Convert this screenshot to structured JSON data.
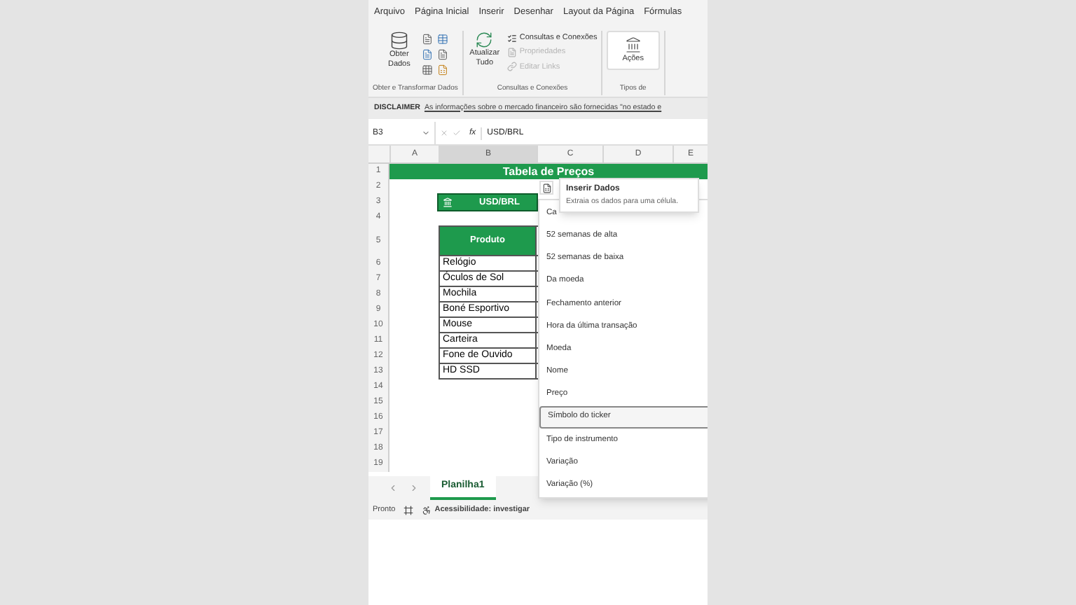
{
  "ribbon_tabs": [
    "Arquivo",
    "Página Inicial",
    "Inserir",
    "Desenhar",
    "Layout da Página",
    "Fórmulas"
  ],
  "ribbon_groups": [
    {
      "kind": "data",
      "label": "Obter e Transformar Dados",
      "large_button": "Obter Dados"
    },
    {
      "kind": "queries",
      "label": "Consultas e Conexões",
      "large_button": "Atualizar Tudo",
      "small_buttons": [
        {
          "label": "Consultas e Conexões",
          "disabled": false
        },
        {
          "label": "Propriedades",
          "disabled": true
        },
        {
          "label": "Editar Links",
          "disabled": true
        }
      ]
    },
    {
      "kind": "types",
      "label": "Tipos de",
      "large_button": "Ações"
    }
  ],
  "disclaimer": {
    "label": "DISCLAIMER",
    "link": "As informações sobre o mercado financeiro são fornecidas \"no estado e"
  },
  "formula_bar": {
    "name_box": "B3",
    "fx": "fx",
    "value": "USD/BRL"
  },
  "sheet": {
    "columns": [
      "A",
      "B",
      "C",
      "D",
      "E"
    ],
    "rows": [
      {
        "number": "1",
        "kind": "title",
        "text": "Tabela de Preços"
      },
      {
        "number": "2",
        "kind": "empty"
      },
      {
        "number": "3",
        "kind": "ticker",
        "text": "USD/BRL",
        "selected": true
      },
      {
        "number": "4",
        "kind": "empty"
      },
      {
        "number": "5",
        "kind": "header",
        "text": "Produto"
      },
      {
        "number": "6",
        "kind": "product",
        "text": "Relógio"
      },
      {
        "number": "7",
        "kind": "product",
        "text": "Óculos de Sol"
      },
      {
        "number": "8",
        "kind": "product",
        "text": "Mochila"
      },
      {
        "number": "9",
        "kind": "product",
        "text": "Boné Esportivo"
      },
      {
        "number": "10",
        "kind": "product",
        "text": "Mouse"
      },
      {
        "number": "11",
        "kind": "product",
        "text": "Carteira"
      },
      {
        "number": "12",
        "kind": "product",
        "text": "Fone de Ouvido"
      },
      {
        "number": "13",
        "kind": "product",
        "text": "HD SSD"
      },
      {
        "number": "14",
        "kind": "empty"
      },
      {
        "number": "15",
        "kind": "empty"
      },
      {
        "number": "16",
        "kind": "empty"
      },
      {
        "number": "17",
        "kind": "empty"
      },
      {
        "number": "18",
        "kind": "empty"
      },
      {
        "number": "19",
        "kind": "empty"
      }
    ]
  },
  "tooltip": {
    "title": "Inserir Dados",
    "description": "Extraia os dados para uma célula."
  },
  "menu": {
    "items": [
      {
        "label": "Ca",
        "selected": false
      },
      {
        "label": "52 semanas de alta",
        "selected": false
      },
      {
        "label": "52 semanas de baixa",
        "selected": false
      },
      {
        "label": "Da moeda",
        "selected": false
      },
      {
        "label": "Fechamento anterior",
        "selected": false
      },
      {
        "label": "Hora da última transação",
        "selected": false
      },
      {
        "label": "Moeda",
        "selected": false
      },
      {
        "label": "Nome",
        "selected": false
      },
      {
        "label": "Preço",
        "selected": false
      },
      {
        "label": "Símbolo do ticker",
        "selected": true
      },
      {
        "label": "Tipo de instrumento",
        "selected": false
      },
      {
        "label": "Variação",
        "selected": false
      },
      {
        "label": "Variação (%)",
        "selected": false
      }
    ]
  },
  "sheet_tabs": [
    {
      "label": "Planilha1",
      "selected": true
    }
  ],
  "status_bar": {
    "status": "Pronto",
    "accessibility": "Acessibilidade: investigar"
  }
}
